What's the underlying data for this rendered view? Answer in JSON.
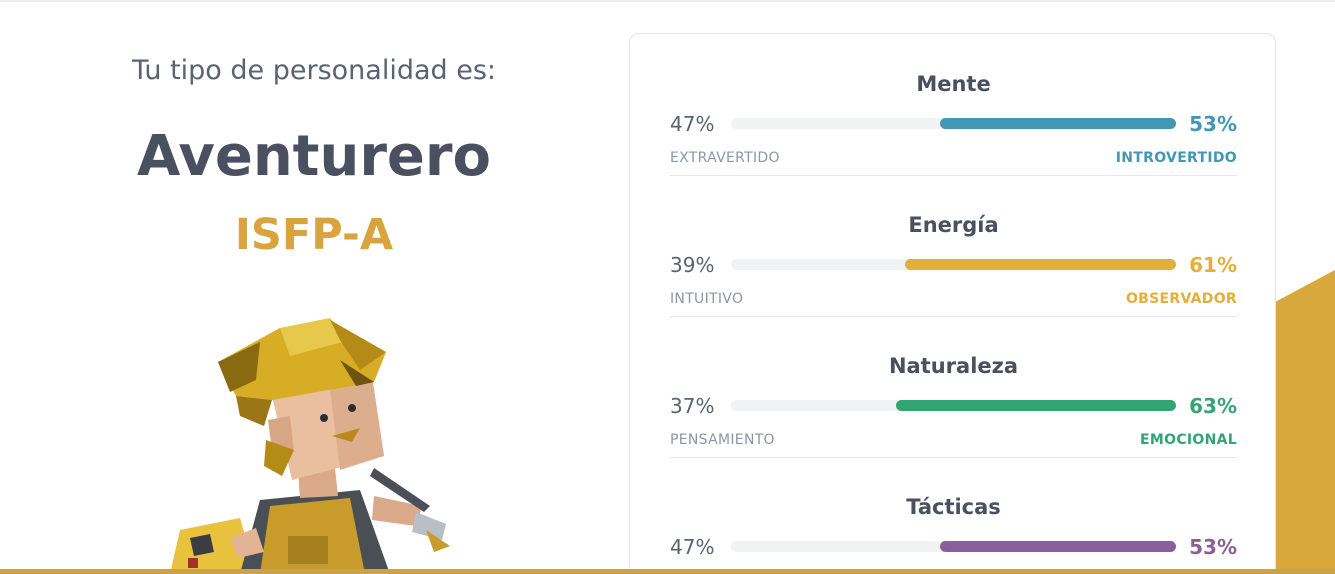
{
  "header": {
    "intro": "Tu tipo de personalidad es:",
    "type_name": "Aventurero",
    "type_code": "ISFP-A"
  },
  "colors": {
    "mente": "#4298b4",
    "energia": "#e4ae3a",
    "naturaleza": "#33a474",
    "tacticas": "#88619a",
    "title": "#4b5060",
    "code": "#d9a33d"
  },
  "traits": [
    {
      "title": "Mente",
      "left_pct": "47%",
      "right_pct": "53%",
      "left_label": "EXTRAVERTIDO",
      "right_label": "INTROVERTIDO",
      "fill": 0.53,
      "color_key": "mente"
    },
    {
      "title": "Energía",
      "left_pct": "39%",
      "right_pct": "61%",
      "left_label": "INTUITIVO",
      "right_label": "OBSERVADOR",
      "fill": 0.61,
      "color_key": "energia"
    },
    {
      "title": "Naturaleza",
      "left_pct": "37%",
      "right_pct": "63%",
      "left_label": "PENSAMIENTO",
      "right_label": "EMOCIONAL",
      "fill": 0.63,
      "color_key": "naturaleza"
    },
    {
      "title": "Tácticas",
      "left_pct": "47%",
      "right_pct": "53%",
      "left_label": "",
      "right_label": "",
      "fill": 0.53,
      "color_key": "tacticas"
    }
  ],
  "icons": {
    "avatar": "adventurer-illustration-icon"
  }
}
